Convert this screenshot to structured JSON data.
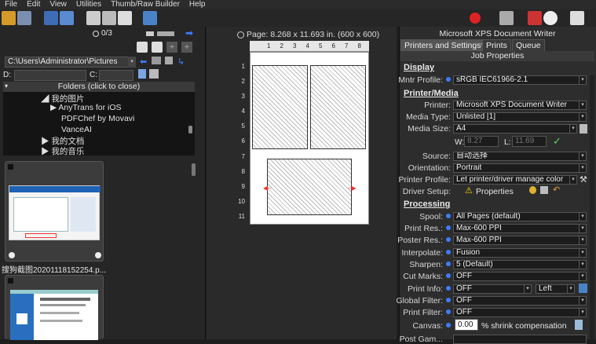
{
  "menu": [
    "File",
    "Edit",
    "View",
    "Utilities",
    "Thumb/Raw Builder",
    "Help"
  ],
  "left": {
    "counter": "0/3",
    "path": "C:\\Users\\Administrator\\Pictures",
    "drive_label_d": "D:",
    "drive_label_c": "C:",
    "folders_header": "Folders (click to close)",
    "tree": [
      "我的图片",
      "AnyTrans for iOS",
      "PDFChef by Movavi",
      "VanceAI",
      "我的文档",
      "我的音乐"
    ],
    "thumb_caption": "搜狗截图20201118152254.p..."
  },
  "preview": {
    "page_info": "Page: 8.268 x 11.693 in.  (600 x 600)",
    "ruler_top": [
      "1",
      "2",
      "3",
      "4",
      "5",
      "6",
      "7",
      "8"
    ],
    "ruler_left": [
      "1",
      "2",
      "3",
      "4",
      "5",
      "6",
      "7",
      "8",
      "9",
      "10",
      "11"
    ]
  },
  "right": {
    "printer_title": "Microsoft XPS Document Writer",
    "tabs": [
      "Printers and Settings*",
      "Prints",
      "Queue"
    ],
    "job_properties": "Job Properties",
    "display_header": "Display",
    "mntr_profile_label": "Mntr Profile:",
    "mntr_profile_value": "sRGB IEC61966-2.1",
    "printer_media_header": "Printer/Media",
    "printer_label": "Printer:",
    "printer_value": "Microsoft XPS Document Writer",
    "media_type_label": "Media Type:",
    "media_type_value": "Unlisted [1]",
    "media_size_label": "Media Size:",
    "media_size_value": "A4",
    "w_label": "W:",
    "w_value": "8.27",
    "l_label": "L:",
    "l_value": "11.69",
    "source_label": "Source:",
    "source_value": "自动选择",
    "orientation_label": "Orientation:",
    "orientation_value": "Portrait",
    "printer_profile_label": "Printer Profile:",
    "printer_profile_value": "Let printer/driver manage color",
    "driver_setup_label": "Driver Setup:",
    "properties_label": "Properties",
    "processing_header": "Processing",
    "spool_label": "Spool:",
    "spool_value": "All Pages (default)",
    "print_res_label": "Print Res.:",
    "print_res_value": "Max-600 PPI",
    "poster_res_label": "Poster Res.:",
    "poster_res_value": "Max-600 PPI",
    "interpolate_label": "Interpolate:",
    "interpolate_value": "Fusion",
    "sharpen_label": "Sharpen:",
    "sharpen_value": "5 (Default)",
    "cut_marks_label": "Cut Marks:",
    "cut_marks_value": "OFF",
    "print_info_label": "Print Info:",
    "print_info_value": "OFF",
    "print_info_pos": "Left",
    "global_filter_label": "Global Filter:",
    "global_filter_value": "OFF",
    "print_filter_label": "Print Filter:",
    "print_filter_value": "OFF",
    "canvas_label": "Canvas:",
    "canvas_value": "0.00",
    "canvas_suffix": "% shrink compensation",
    "last_label": "Post Gam..."
  },
  "colors": {
    "accent": "#3c7dff",
    "check": "#5fd35f",
    "warning": "#ffd400"
  }
}
